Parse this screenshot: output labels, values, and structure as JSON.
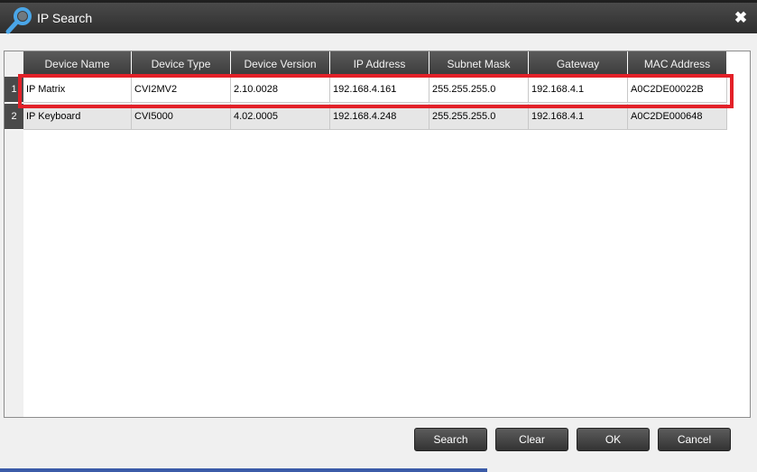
{
  "window": {
    "title": "IP Search",
    "close_icon": "close-icon",
    "search_icon": "search-icon"
  },
  "table": {
    "columns": [
      "Device Name",
      "Device Type",
      "Device Version",
      "IP Address",
      "Subnet Mask",
      "Gateway",
      "MAC Address"
    ],
    "rows": [
      {
        "num": "1",
        "cells": [
          "IP Matrix",
          "CVI2MV2",
          "2.10.0028",
          "192.168.4.161",
          "255.255.255.0",
          "192.168.4.1",
          "A0C2DE00022B"
        ]
      },
      {
        "num": "2",
        "cells": [
          "IP Keyboard",
          "CVI5000",
          "4.02.0005",
          "192.168.4.248",
          "255.255.255.0",
          "192.168.4.1",
          "A0C2DE000648"
        ]
      }
    ],
    "highlight_color": "#e32028"
  },
  "buttons": {
    "search": "Search",
    "clear": "Clear",
    "ok": "OK",
    "cancel": "Cancel"
  }
}
